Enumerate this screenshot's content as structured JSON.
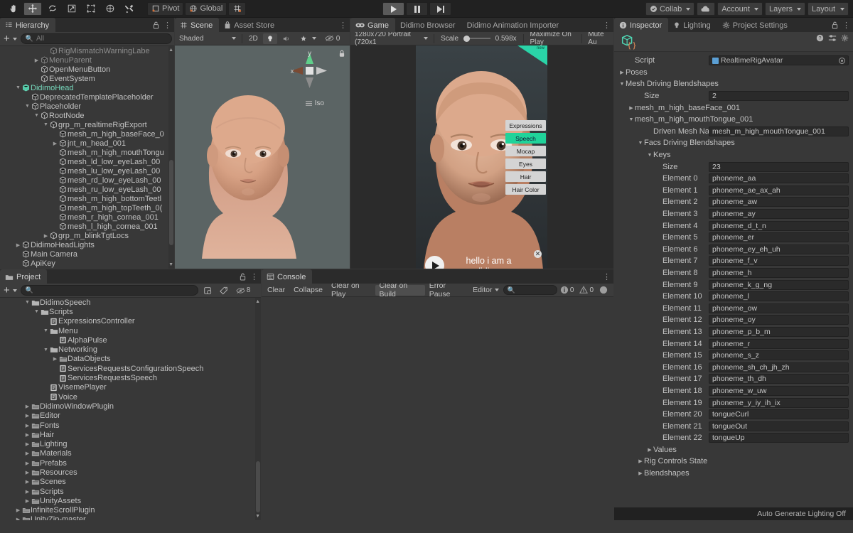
{
  "toolbar": {
    "left_tools": [
      {
        "name": "hand-tool",
        "glyph": "✋",
        "active": false
      },
      {
        "name": "move-tool",
        "glyph": "✛",
        "active": true
      },
      {
        "name": "rotate-tool",
        "glyph": "⟳",
        "active": false
      },
      {
        "name": "scale-tool",
        "glyph": "⤢",
        "active": false
      },
      {
        "name": "rect-tool",
        "glyph": "▣",
        "active": false
      },
      {
        "name": "transform-tool",
        "glyph": "✾",
        "active": false
      },
      {
        "name": "custom-tool",
        "glyph": "⚒",
        "active": false
      }
    ],
    "pivot_label": "Pivot",
    "global_label": "Global",
    "grid_label": "",
    "play_label": "▶",
    "pause_label": "❚❚",
    "step_label": "▶❙",
    "collab_label": "Collab",
    "cloud_label": "",
    "account_label": "Account",
    "layers_label": "Layers",
    "layout_label": "Layout"
  },
  "hierarchy": {
    "tab_label": "Hierarchy",
    "search_placeholder": "All",
    "create_label": "+",
    "items": [
      {
        "label": "RigMismatchWarningLabe",
        "depth": 4,
        "arrow": "",
        "dim": true
      },
      {
        "label": "MenuParent",
        "depth": 3,
        "arrow": "right",
        "dim": true
      },
      {
        "label": "OpenMenuButton",
        "depth": 3,
        "arrow": "",
        "dim": false
      },
      {
        "label": "EventSystem",
        "depth": 3,
        "arrow": "",
        "dim": false
      },
      {
        "label": "DidimoHead",
        "depth": 1,
        "arrow": "down",
        "dim": false,
        "prefab": true
      },
      {
        "label": "DeprecatedTemplatePlaceholder",
        "depth": 2,
        "arrow": "",
        "dim": false
      },
      {
        "label": "Placeholder",
        "depth": 2,
        "arrow": "down",
        "dim": false
      },
      {
        "label": "RootNode",
        "depth": 3,
        "arrow": "down",
        "dim": false
      },
      {
        "label": "grp_m_realtimeRigExport",
        "depth": 4,
        "arrow": "down",
        "dim": false
      },
      {
        "label": "mesh_m_high_baseFace_0",
        "depth": 5,
        "arrow": "",
        "dim": false
      },
      {
        "label": "jnt_m_head_001",
        "depth": 5,
        "arrow": "right",
        "dim": false
      },
      {
        "label": "mesh_m_high_mouthTongu",
        "depth": 5,
        "arrow": "",
        "dim": false
      },
      {
        "label": "mesh_ld_low_eyeLash_00",
        "depth": 5,
        "arrow": "",
        "dim": false
      },
      {
        "label": "mesh_lu_low_eyeLash_00",
        "depth": 5,
        "arrow": "",
        "dim": false
      },
      {
        "label": "mesh_rd_low_eyeLash_00",
        "depth": 5,
        "arrow": "",
        "dim": false
      },
      {
        "label": "mesh_ru_low_eyeLash_00",
        "depth": 5,
        "arrow": "",
        "dim": false
      },
      {
        "label": "mesh_m_high_bottomTeetl",
        "depth": 5,
        "arrow": "",
        "dim": false
      },
      {
        "label": "mesh_m_high_topTeeth_0(",
        "depth": 5,
        "arrow": "",
        "dim": false
      },
      {
        "label": "mesh_r_high_cornea_001",
        "depth": 5,
        "arrow": "",
        "dim": false
      },
      {
        "label": "mesh_l_high_cornea_001",
        "depth": 5,
        "arrow": "",
        "dim": false
      },
      {
        "label": "grp_m_blinkTgtLocs",
        "depth": 4,
        "arrow": "right",
        "dim": false
      },
      {
        "label": "DidimoHeadLights",
        "depth": 1,
        "arrow": "right",
        "dim": false
      },
      {
        "label": "Main Camera",
        "depth": 1,
        "arrow": "",
        "dim": false
      },
      {
        "label": "ApiKey",
        "depth": 1,
        "arrow": "",
        "dim": false
      }
    ]
  },
  "scene": {
    "tabs": [
      {
        "label": "Scene",
        "icon": "grid-icon",
        "selected": true
      },
      {
        "label": "Asset Store",
        "icon": "store-icon",
        "selected": false
      }
    ],
    "shading_mode": "Shaded",
    "mode_2d": "2D",
    "light_icon": "light-icon",
    "audio_icon": "audio-icon",
    "fx_icon": "fx-icon",
    "hidden_count": "0",
    "gizmo_axis_y": "y",
    "gizmo_axis_x": "x",
    "projection_label": "Iso"
  },
  "game": {
    "tabs": [
      {
        "label": "Game",
        "icon": "game-icon",
        "selected": true
      },
      {
        "label": "Didimo Browser",
        "icon": "",
        "selected": false
      },
      {
        "label": "Didimo Animation Importer",
        "icon": "",
        "selected": false
      }
    ],
    "resolution": "1280x720 Portrait (720x1",
    "scale_label": "Scale",
    "scale_value": "0.598x",
    "maximize_label": "Maximize On Play",
    "mute_label": "Mute Au",
    "overlay_buttons": [
      {
        "label": "Expressions",
        "active": false
      },
      {
        "label": "Speech",
        "active": true
      },
      {
        "label": "Mocap",
        "active": false
      },
      {
        "label": "Eyes",
        "active": false
      },
      {
        "label": "Hair",
        "active": false
      },
      {
        "label": "Hair Color",
        "active": false
      }
    ],
    "subtitle_line1": "hello i am a",
    "subtitle_line2": "didimo",
    "play_icon": "play-icon",
    "close_icon": "close-icon",
    "corner_badge": "new"
  },
  "project": {
    "tab_label": "Project",
    "search_placeholder": "",
    "hidden_count": "8",
    "items": [
      {
        "label": "DidimoSpeech",
        "depth": 2,
        "arrow": "down",
        "type": "folder-open"
      },
      {
        "label": "Scripts",
        "depth": 3,
        "arrow": "down",
        "type": "folder-open"
      },
      {
        "label": "ExpressionsController",
        "depth": 4,
        "arrow": "",
        "type": "script"
      },
      {
        "label": "Menu",
        "depth": 4,
        "arrow": "down",
        "type": "folder-open"
      },
      {
        "label": "AlphaPulse",
        "depth": 5,
        "arrow": "",
        "type": "script"
      },
      {
        "label": "Networking",
        "depth": 4,
        "arrow": "down",
        "type": "folder-open"
      },
      {
        "label": "DataObjects",
        "depth": 5,
        "arrow": "right",
        "type": "folder"
      },
      {
        "label": "ServicesRequestsConfigurationSpeech",
        "depth": 5,
        "arrow": "",
        "type": "script"
      },
      {
        "label": "ServicesRequestsSpeech",
        "depth": 5,
        "arrow": "",
        "type": "script"
      },
      {
        "label": "VisemePlayer",
        "depth": 4,
        "arrow": "",
        "type": "script"
      },
      {
        "label": "Voice",
        "depth": 4,
        "arrow": "",
        "type": "script"
      },
      {
        "label": "DidimoWindowPlugin",
        "depth": 2,
        "arrow": "right",
        "type": "folder"
      },
      {
        "label": "Editor",
        "depth": 2,
        "arrow": "right",
        "type": "folder"
      },
      {
        "label": "Fonts",
        "depth": 2,
        "arrow": "right",
        "type": "folder"
      },
      {
        "label": "Hair",
        "depth": 2,
        "arrow": "right",
        "type": "folder"
      },
      {
        "label": "Lighting",
        "depth": 2,
        "arrow": "right",
        "type": "folder"
      },
      {
        "label": "Materials",
        "depth": 2,
        "arrow": "right",
        "type": "folder"
      },
      {
        "label": "Prefabs",
        "depth": 2,
        "arrow": "right",
        "type": "folder"
      },
      {
        "label": "Resources",
        "depth": 2,
        "arrow": "right",
        "type": "folder"
      },
      {
        "label": "Scenes",
        "depth": 2,
        "arrow": "right",
        "type": "folder"
      },
      {
        "label": "Scripts",
        "depth": 2,
        "arrow": "right",
        "type": "folder"
      },
      {
        "label": "UnityAssets",
        "depth": 2,
        "arrow": "right",
        "type": "folder"
      },
      {
        "label": "InfiniteScrollPlugin",
        "depth": 1,
        "arrow": "right",
        "type": "folder"
      },
      {
        "label": "UnityZip-master",
        "depth": 1,
        "arrow": "right",
        "type": "folder"
      }
    ]
  },
  "console": {
    "tab_label": "Console",
    "buttons": [
      {
        "label": "Clear",
        "pressed": false
      },
      {
        "label": "Collapse",
        "pressed": false
      },
      {
        "label": "Clear on Play",
        "pressed": false
      },
      {
        "label": "Clear on Build",
        "pressed": true
      },
      {
        "label": "Error Pause",
        "pressed": false
      }
    ],
    "editor_dropdown": "Editor",
    "search_placeholder": "",
    "log_count": "0",
    "warn_count": "0",
    "error_count": ""
  },
  "inspector": {
    "tabs": [
      {
        "label": "Inspector",
        "icon": "info-icon",
        "selected": true
      },
      {
        "label": "Lighting",
        "icon": "light-icon",
        "selected": false
      },
      {
        "label": "Project Settings",
        "icon": "gear-icon",
        "selected": false
      }
    ],
    "component_icon": "script-asset-icon",
    "rows": [
      {
        "type": "field",
        "indent": 1,
        "label": "Script",
        "value": "RealtimeRigAvatar",
        "objref": true,
        "picker": true
      },
      {
        "type": "fold",
        "indent": 0,
        "label": "Poses",
        "arrow": "right"
      },
      {
        "type": "fold",
        "indent": 0,
        "label": "Mesh Driving Blendshapes",
        "arrow": "down"
      },
      {
        "type": "field",
        "indent": 2,
        "label": "Size",
        "value": "2"
      },
      {
        "type": "fold",
        "indent": 1,
        "label": "mesh_m_high_baseFace_001",
        "arrow": "right"
      },
      {
        "type": "fold",
        "indent": 1,
        "label": "mesh_m_high_mouthTongue_001",
        "arrow": "down"
      },
      {
        "type": "field",
        "indent": 3,
        "label": "Driven Mesh Name",
        "value": "mesh_m_high_mouthTongue_001"
      },
      {
        "type": "fold",
        "indent": 2,
        "label": "Facs Driving Blendshapes",
        "arrow": "down"
      },
      {
        "type": "fold",
        "indent": 3,
        "label": "Keys",
        "arrow": "down"
      },
      {
        "type": "field",
        "indent": 4,
        "label": "Size",
        "value": "23"
      },
      {
        "type": "field",
        "indent": 4,
        "label": "Element 0",
        "value": "phoneme_aa"
      },
      {
        "type": "field",
        "indent": 4,
        "label": "Element 1",
        "value": "phoneme_ae_ax_ah"
      },
      {
        "type": "field",
        "indent": 4,
        "label": "Element 2",
        "value": "phoneme_aw"
      },
      {
        "type": "field",
        "indent": 4,
        "label": "Element 3",
        "value": "phoneme_ay"
      },
      {
        "type": "field",
        "indent": 4,
        "label": "Element 4",
        "value": "phoneme_d_t_n"
      },
      {
        "type": "field",
        "indent": 4,
        "label": "Element 5",
        "value": "phoneme_er"
      },
      {
        "type": "field",
        "indent": 4,
        "label": "Element 6",
        "value": "phoneme_ey_eh_uh"
      },
      {
        "type": "field",
        "indent": 4,
        "label": "Element 7",
        "value": "phoneme_f_v"
      },
      {
        "type": "field",
        "indent": 4,
        "label": "Element 8",
        "value": "phoneme_h"
      },
      {
        "type": "field",
        "indent": 4,
        "label": "Element 9",
        "value": "phoneme_k_g_ng"
      },
      {
        "type": "field",
        "indent": 4,
        "label": "Element 10",
        "value": "phoneme_l"
      },
      {
        "type": "field",
        "indent": 4,
        "label": "Element 11",
        "value": "phoneme_ow"
      },
      {
        "type": "field",
        "indent": 4,
        "label": "Element 12",
        "value": "phoneme_oy"
      },
      {
        "type": "field",
        "indent": 4,
        "label": "Element 13",
        "value": "phoneme_p_b_m"
      },
      {
        "type": "field",
        "indent": 4,
        "label": "Element 14",
        "value": "phoneme_r"
      },
      {
        "type": "field",
        "indent": 4,
        "label": "Element 15",
        "value": "phoneme_s_z"
      },
      {
        "type": "field",
        "indent": 4,
        "label": "Element 16",
        "value": "phoneme_sh_ch_jh_zh"
      },
      {
        "type": "field",
        "indent": 4,
        "label": "Element 17",
        "value": "phoneme_th_dh"
      },
      {
        "type": "field",
        "indent": 4,
        "label": "Element 18",
        "value": "phoneme_w_uw"
      },
      {
        "type": "field",
        "indent": 4,
        "label": "Element 19",
        "value": "phoneme_y_iy_ih_ix"
      },
      {
        "type": "field",
        "indent": 4,
        "label": "Element 20",
        "value": "tongueCurl"
      },
      {
        "type": "field",
        "indent": 4,
        "label": "Element 21",
        "value": "tongueOut"
      },
      {
        "type": "field",
        "indent": 4,
        "label": "Element 22",
        "value": "tongueUp"
      },
      {
        "type": "fold",
        "indent": 3,
        "label": "Values",
        "arrow": "right"
      },
      {
        "type": "fold",
        "indent": 2,
        "label": "Rig Controls State",
        "arrow": "right"
      },
      {
        "type": "fold",
        "indent": 2,
        "label": "Blendshapes",
        "arrow": "right"
      }
    ]
  },
  "status": {
    "message": "Auto Generate Lighting Off"
  },
  "colors": {
    "accent_teal": "#20d39a",
    "panel_bg": "#383838",
    "toolbar_bg": "#3c3c3c",
    "dark_bg": "#212121",
    "scene_bg": "#5b6464",
    "field_bg": "#2a2a2a"
  }
}
